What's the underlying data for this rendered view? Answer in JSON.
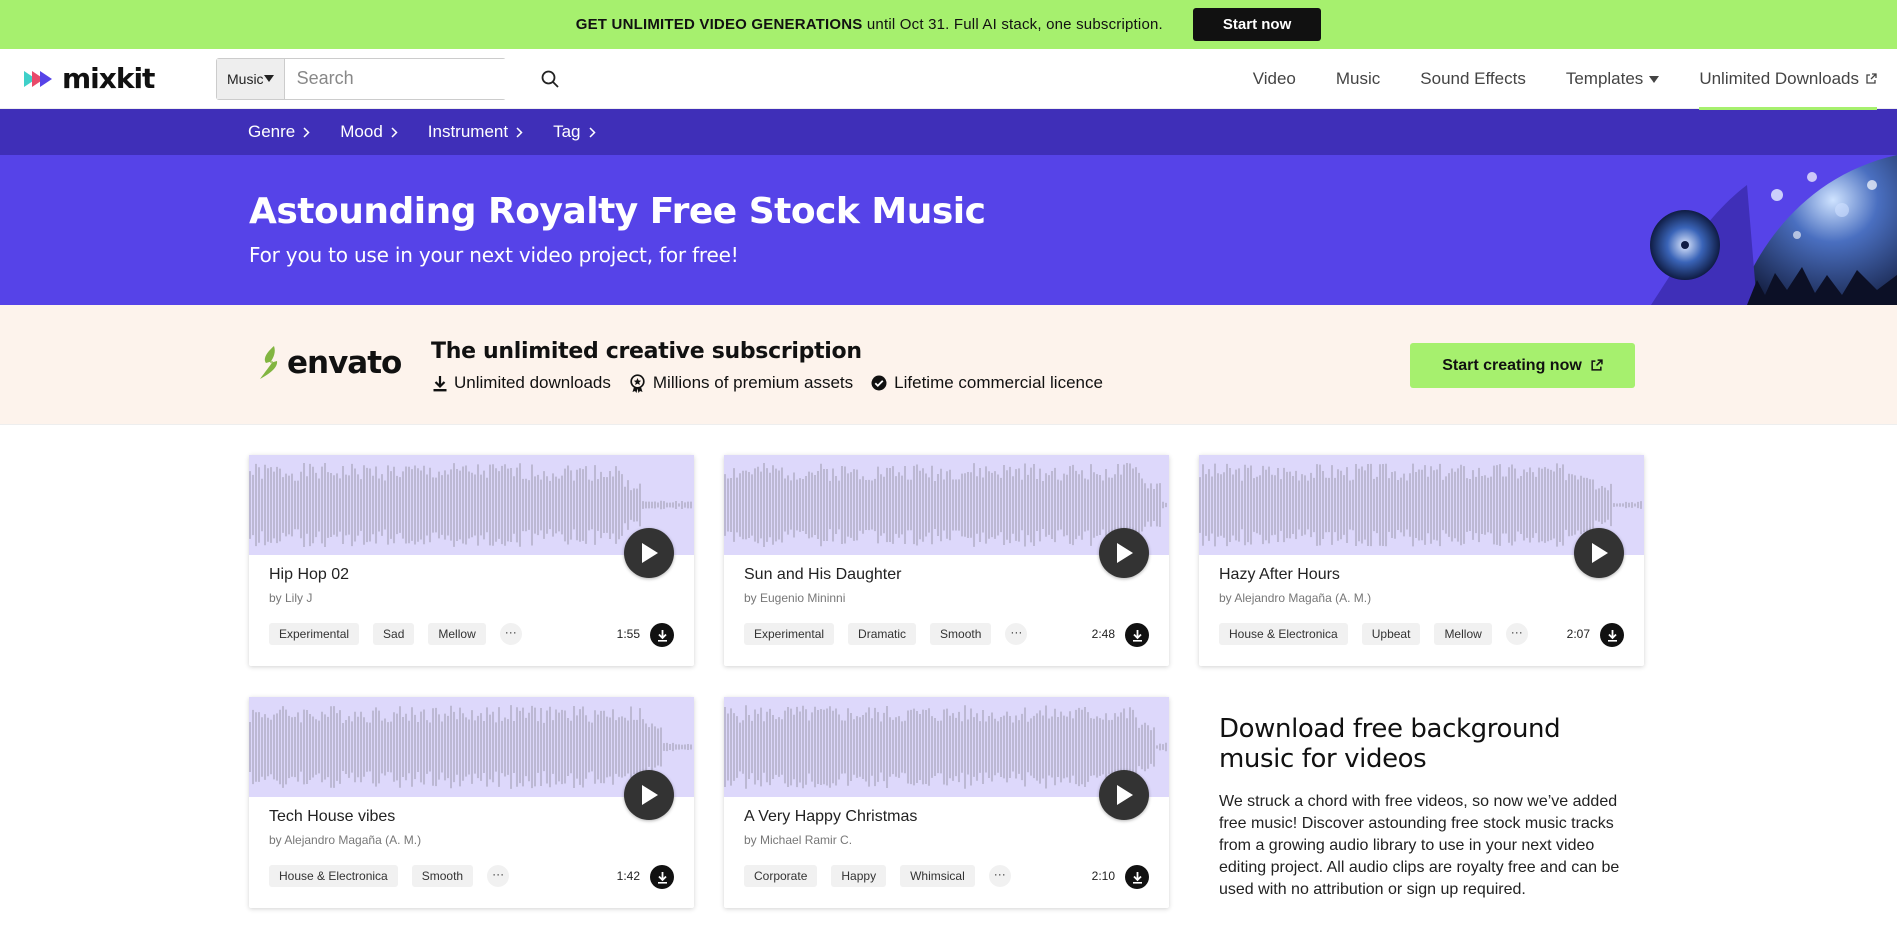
{
  "promo": {
    "bold": "GET UNLIMITED VIDEO GENERATIONS",
    "text": "until Oct 31. Full AI stack, one subscription.",
    "button": "Start now"
  },
  "header": {
    "logo": "mixkit",
    "search_scope": "Music",
    "search_placeholder": "Search",
    "nav": [
      "Video",
      "Music",
      "Sound Effects",
      "Templates",
      "Unlimited Downloads"
    ]
  },
  "categories": [
    "Genre",
    "Mood",
    "Instrument",
    "Tag"
  ],
  "hero": {
    "title": "Astounding Royalty Free Stock Music",
    "subtitle": "For you to use in your next video project, for free!"
  },
  "envato": {
    "logo": "envato",
    "title": "The unlimited creative subscription",
    "features": [
      "Unlimited downloads",
      "Millions of premium assets",
      "Lifetime commercial licence"
    ],
    "button": "Start creating now"
  },
  "tracks": [
    {
      "title": "Hip Hop 02",
      "author": "by Lily J",
      "tags": [
        "Experimental",
        "Sad",
        "Mellow"
      ],
      "more": "···",
      "duration": "1:55"
    },
    {
      "title": "Sun and His Daughter",
      "author": "by Eugenio Mininni",
      "tags": [
        "Experimental",
        "Dramatic",
        "Smooth"
      ],
      "more": "···",
      "duration": "2:48"
    },
    {
      "title": "Hazy After Hours",
      "author": "by Alejandro Magaña (A. M.)",
      "tags": [
        "House & Electronica",
        "Upbeat",
        "Mellow"
      ],
      "more": "···",
      "duration": "2:07"
    },
    {
      "title": "Tech House vibes",
      "author": "by Alejandro Magaña (A. M.)",
      "tags": [
        "House & Electronica",
        "Smooth"
      ],
      "more": "···",
      "duration": "1:42"
    },
    {
      "title": "A Very Happy Christmas",
      "author": "by Michael Ramir C.",
      "tags": [
        "Corporate",
        "Happy",
        "Whimsical"
      ],
      "more": "···",
      "duration": "2:10"
    }
  ],
  "side": {
    "title": "Download free background music for videos",
    "body": "We struck a chord with free videos, so now we’ve added free music! Discover astounding free stock music tracks from a growing audio library to use in your next video editing project. All audio clips are royalty free and can be used with no attribution or sign up required."
  },
  "colors": {
    "promo_green": "#a6f06e",
    "category_purple": "#3f2fb8",
    "hero_purple": "#5643e8",
    "waveform_bg": "#ddd8fb",
    "envato_bg": "#fdf3ec"
  }
}
